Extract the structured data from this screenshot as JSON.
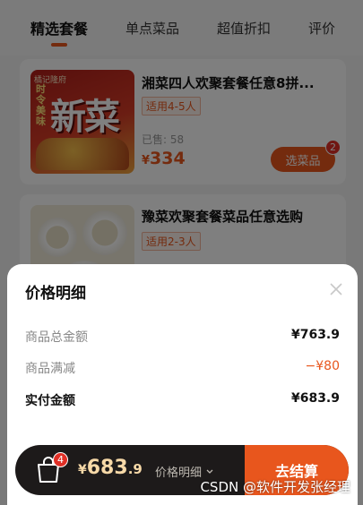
{
  "tabs": [
    {
      "label": "精选套餐",
      "active": true
    },
    {
      "label": "单点菜品",
      "active": false
    },
    {
      "label": "超值折扣",
      "active": false
    },
    {
      "label": "评价",
      "active": false
    }
  ],
  "products": [
    {
      "title": "湘菜四人欢聚套餐任意8拼...",
      "tag": "适用4-5人",
      "sold": "已售: 58",
      "currency": "¥",
      "price": "334",
      "button_label": "选菜品",
      "badge_count": "2",
      "thumbnail": {
        "brand": "橘记隆府",
        "headline": "新菜",
        "side_text": "时令美味"
      }
    },
    {
      "title": "豫菜欢聚套餐菜品任意选购",
      "tag": "适用2-3人"
    }
  ],
  "price_sheet": {
    "title": "价格明细",
    "rows": [
      {
        "label": "商品总金额",
        "value": "¥763.9"
      },
      {
        "label": "商品满减",
        "value": "−¥80"
      },
      {
        "label": "实付金额",
        "value": "¥683.9"
      }
    ]
  },
  "bottom_bar": {
    "cart_badge": "4",
    "currency": "¥",
    "total_int": "683",
    "total_dec": ".9",
    "detail_label": "价格明细",
    "checkout_label": "去结算"
  },
  "watermark": "CSDN @软件开发张经理",
  "colors": {
    "accent": "#e8561d",
    "badge": "#e02f26",
    "bar": "#1d1a1a",
    "price_gold": "#f7d9a8"
  },
  "icons": [
    "close-icon",
    "shopping-bag-icon",
    "chevron-down-icon"
  ]
}
